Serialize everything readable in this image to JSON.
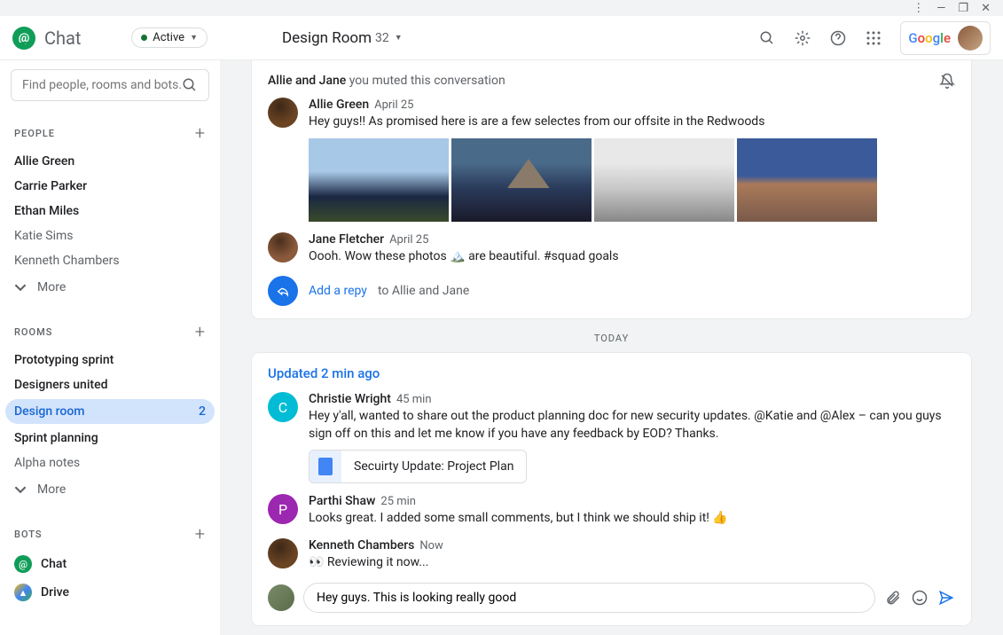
{
  "app": {
    "name": "Chat",
    "status": "Active"
  },
  "search": {
    "placeholder": "Find people, rooms and bots..."
  },
  "sidebar": {
    "sections": {
      "people": {
        "title": "PEOPLE",
        "more": "More"
      },
      "rooms": {
        "title": "ROOMS",
        "more": "More"
      },
      "bots": {
        "title": "BOTS"
      }
    },
    "people": [
      "Allie Green",
      "Carrie Parker",
      "Ethan Miles",
      "Katie Sims",
      "Kenneth Chambers"
    ],
    "rooms": [
      {
        "label": "Prototyping sprint"
      },
      {
        "label": "Designers united"
      },
      {
        "label": "Design room",
        "active": true,
        "badge": "2"
      },
      {
        "label": "Sprint planning"
      },
      {
        "label": "Alpha notes",
        "dim": true
      }
    ],
    "bots": [
      {
        "label": "Chat"
      },
      {
        "label": "Drive"
      }
    ]
  },
  "header": {
    "room": "Design Room",
    "count": "32"
  },
  "thread1": {
    "header_people": "Allie and Jane",
    "header_rest": " you muted this conversation",
    "m1": {
      "author": "Allie Green",
      "time": "April 25",
      "text": "Hey guys!! As promised here is are a few selectes from our offsite in the Redwoods"
    },
    "m2": {
      "author": "Jane Fletcher",
      "time": "April 25",
      "text": "Oooh. Wow these photos 🏔️ are beautiful. #squad goals"
    },
    "reply": {
      "action": "Add a repy",
      "to": "to Allie and Jane"
    }
  },
  "divider": "TODAY",
  "thread2": {
    "updated": "Updated 2 min ago",
    "m1": {
      "author": "Christie Wright",
      "time": "45 min",
      "text": "Hey y'all, wanted to share out the product planning doc for new security updates. @Katie and @Alex – can you guys sign off on this and let me know if you have any feedback by EOD? Thanks.",
      "doc": "Secuirty Update: Project Plan"
    },
    "m2": {
      "author": "Parthi Shaw",
      "time": "25 min",
      "text": "Looks great. I added some small comments, but I think we should ship it! 👍"
    },
    "m3": {
      "author": "Kenneth Chambers",
      "time": "Now",
      "text": "👀 Reviewing it now..."
    },
    "compose": {
      "value": "Hey guys. This is looking really good"
    }
  },
  "google": "Google"
}
